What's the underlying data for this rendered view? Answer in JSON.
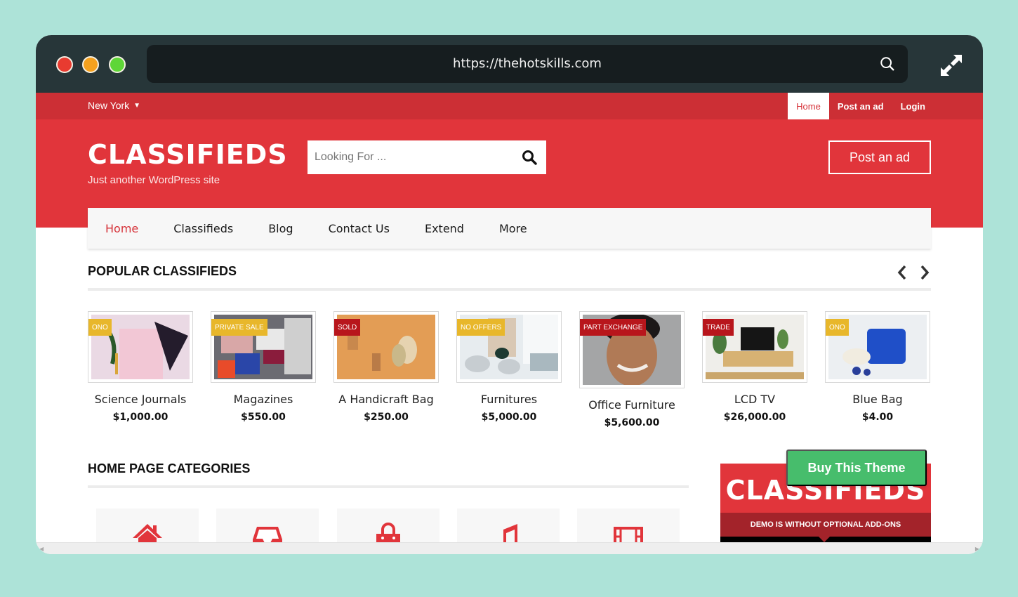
{
  "browser": {
    "url": "https://thehotskills.com",
    "traffic_lights": [
      "close",
      "minimize",
      "maximize"
    ],
    "icons": {
      "search": "search-icon",
      "expand": "expand-icon"
    }
  },
  "topbar": {
    "location": "New York",
    "links": [
      {
        "label": "Home",
        "active": true
      },
      {
        "label": "Post an ad",
        "active": false
      },
      {
        "label": "Login",
        "active": false
      }
    ]
  },
  "header": {
    "site_title": "CLASSIFIEDS",
    "tagline": "Just another WordPress site",
    "search_placeholder": "Looking For ...",
    "post_ad_label": "Post an ad"
  },
  "nav": {
    "items": [
      "Home",
      "Classifieds",
      "Blog",
      "Contact Us",
      "Extend",
      "More"
    ],
    "active": "Home"
  },
  "popular": {
    "title": "POPULAR CLASSIFIEDS",
    "items": [
      {
        "title": "Science Journals",
        "price": "$1,000.00",
        "badge": "ONO",
        "badge_color": "#e8b72b"
      },
      {
        "title": "Magazines",
        "price": "$550.00",
        "badge": "PRIVATE SALE",
        "badge_color": "#e8b72b"
      },
      {
        "title": "A Handicraft Bag",
        "price": "$250.00",
        "badge": "SOLD",
        "badge_color": "#b8161c"
      },
      {
        "title": "Furnitures",
        "price": "$5,000.00",
        "badge": "NO OFFERS",
        "badge_color": "#e8b72b"
      },
      {
        "title": "Office Furniture",
        "price": "$5,600.00",
        "badge": "PART EXCHANGE",
        "badge_color": "#b8161c"
      },
      {
        "title": "LCD TV",
        "price": "$26,000.00",
        "badge": "TRADE",
        "badge_color": "#b8161c"
      },
      {
        "title": "Blue Bag",
        "price": "$4.00",
        "badge": "ONO",
        "badge_color": "#e8b72b"
      }
    ]
  },
  "categories": {
    "title": "HOME PAGE CATEGORIES",
    "icons": [
      "home-icon",
      "inbox-icon",
      "shopping-bag-icon",
      "music-icon",
      "film-icon"
    ]
  },
  "promo": {
    "logo": "CLASSIFIEDS",
    "note": "DEMO IS WITHOUT OPTIONAL ADD-ONS",
    "buy_label": "Buy This Theme"
  },
  "colors": {
    "brand_red": "#e1353b",
    "topbar_red": "#cc2f35",
    "buy_green": "#47bd6c",
    "chrome": "#273639",
    "backdrop": "#ade3d8"
  }
}
